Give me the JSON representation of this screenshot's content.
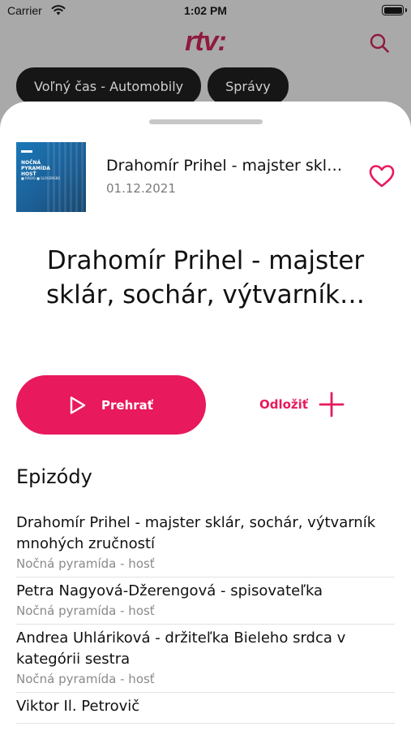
{
  "status_bar": {
    "carrier": "Carrier",
    "time": "1:02 PM"
  },
  "header": {
    "logo": "rtv:",
    "logo_color": "#8f1a3e"
  },
  "chips": [
    {
      "label": "Voľný čas - Automobily"
    },
    {
      "label": "Správy"
    }
  ],
  "episode": {
    "thumbnail": {
      "title": "NOČNÁ PYRAMÍDA HOSŤ",
      "subtitle": "■ RÁDIO ■ SLOVENSKO"
    },
    "short_title": "Drahomír Prihel - majster sklár, sochár, výtvarník mnohých zručností",
    "date": "01.12.2021",
    "title": "Drahomír Prihel - majster sklár, sochár, výtvarník…"
  },
  "actions": {
    "play_label": "Prehrať",
    "save_label": "Odložiť",
    "accent": "#e8195c"
  },
  "episodes_section": {
    "title": "Epizódy",
    "items": [
      {
        "title": "Drahomír Prihel - majster sklár, sochár, výtvarník mnohých zručností",
        "show": "Nočná pyramída - hosť"
      },
      {
        "title": "Petra Nagyová-Džerengová - spisovateľka",
        "show": "Nočná pyramída - hosť"
      },
      {
        "title": "Andrea Uhláriková - držiteľka Bieleho srdca v kategórii sestra",
        "show": "Nočná pyramída - hosť"
      },
      {
        "title": "Viktor Il. Petrovič",
        "show": ""
      }
    ]
  }
}
